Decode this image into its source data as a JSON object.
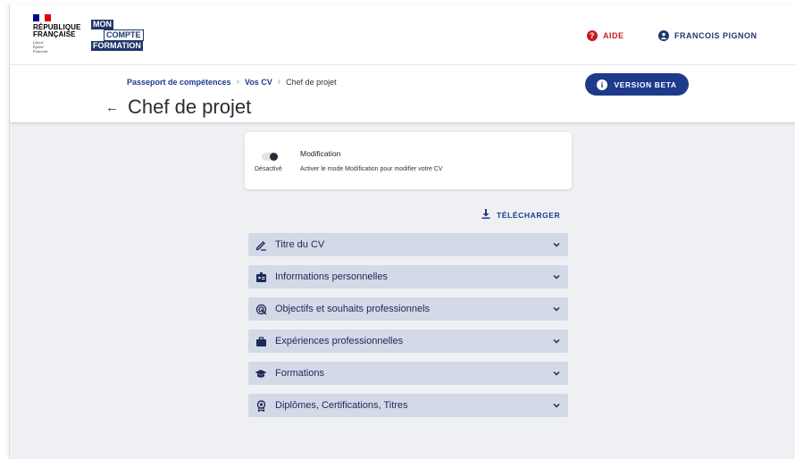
{
  "header": {
    "republic": [
      "RÉPUBLIQUE",
      "FRANÇAISE"
    ],
    "motto": [
      "Liberté",
      "Égalité",
      "Fraternité"
    ],
    "brand": [
      "MON",
      "COMPTE",
      "FORMATION"
    ],
    "help_label": "AIDE",
    "user_label": "FRANCOIS PIGNON",
    "help_icon": "question-circle-icon",
    "user_icon": "user-circle-icon",
    "colors": {
      "primary": "#1e3a8a",
      "danger": "#c9191e"
    }
  },
  "breadcrumb": {
    "items": [
      "Passeport de compétences",
      "Vos CV",
      "Chef de projet"
    ]
  },
  "page": {
    "title": "Chef de projet",
    "back_icon": "arrow-left-icon",
    "beta_label": "VERSION BETA",
    "beta_icon": "info-circle-icon"
  },
  "modification": {
    "title": "Modification",
    "status": "Désactivé",
    "description": "Activer le mode Modification pour modifier votre CV",
    "enabled": false
  },
  "download": {
    "label": "TÉLÉCHARGER",
    "icon": "download-icon"
  },
  "sections": [
    {
      "label": "Titre du CV",
      "icon": "pen-icon"
    },
    {
      "label": "Informations personnelles",
      "icon": "id-badge-icon"
    },
    {
      "label": "Objectifs et souhaits professionnels",
      "icon": "target-icon"
    },
    {
      "label": "Expériences professionnelles",
      "icon": "briefcase-icon"
    },
    {
      "label": "Formations",
      "icon": "graduation-cap-icon"
    },
    {
      "label": "Diplômes, Certifications, Titres",
      "icon": "award-icon"
    }
  ]
}
